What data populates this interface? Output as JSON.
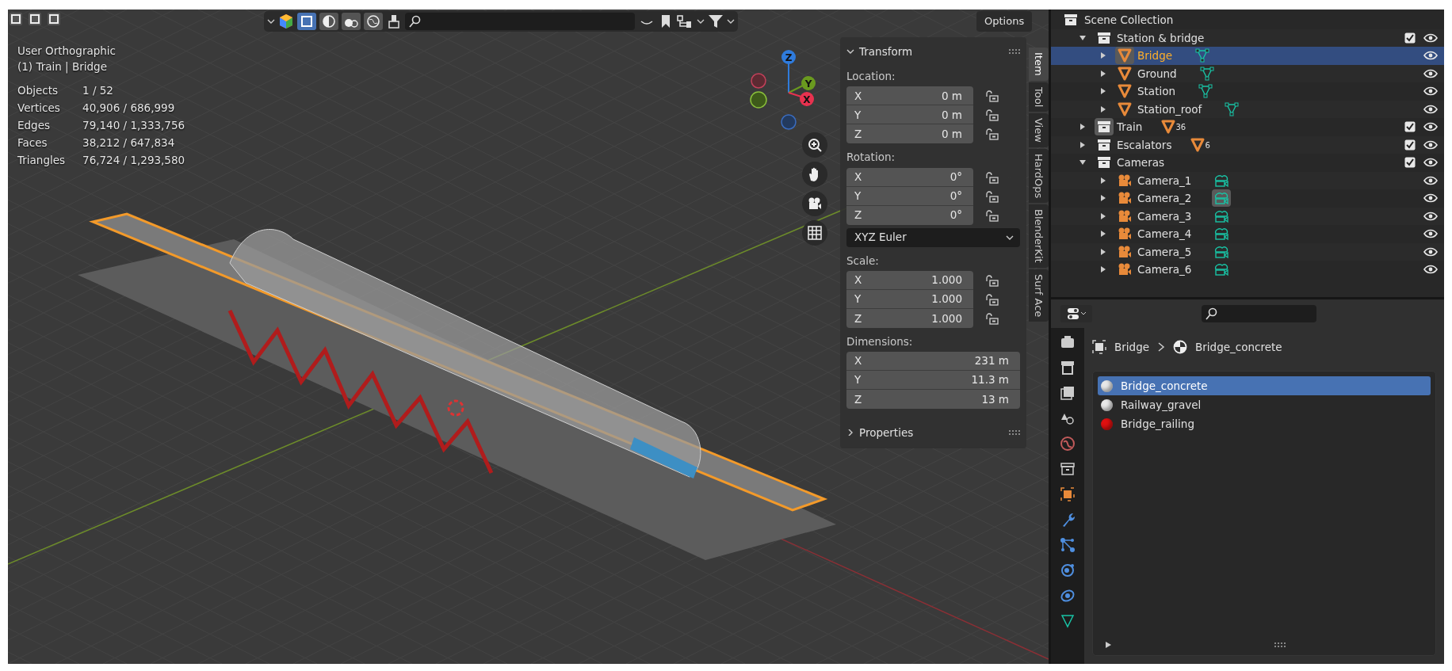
{
  "viewport": {
    "shading_modes": [
      {
        "selected": true
      },
      {
        "selected": false
      },
      {
        "selected": false
      },
      {
        "selected": false
      }
    ],
    "options_button": "Options",
    "view_name": "User Orthographic",
    "context": "(1) Train | Bridge",
    "stats": [
      {
        "label": "Objects",
        "value": "1 / 52"
      },
      {
        "label": "Vertices",
        "value": "40,906 / 686,999"
      },
      {
        "label": "Edges",
        "value": "79,140 / 1,333,756"
      },
      {
        "label": "Faces",
        "value": "38,212 / 647,834"
      },
      {
        "label": "Triangles",
        "value": "76,724 / 1,293,580"
      }
    ],
    "gizmo_axes": [
      {
        "label": "Z"
      },
      {
        "label": "Y"
      },
      {
        "label": "X"
      }
    ]
  },
  "sidebar": {
    "tabs": [
      {
        "label": "Item",
        "selected": true
      },
      {
        "label": "Tool",
        "selected": false
      },
      {
        "label": "View",
        "selected": false
      },
      {
        "label": "HardOps",
        "selected": false
      },
      {
        "label": "BlenderKit",
        "selected": false
      },
      {
        "label": "Surf Ace",
        "selected": false
      }
    ],
    "transform": {
      "title": "Transform",
      "expanded": true,
      "groups": [
        {
          "label": "Location:",
          "lockable": true,
          "fields": [
            {
              "axis": "X",
              "value": "0 m"
            },
            {
              "axis": "Y",
              "value": "0 m"
            },
            {
              "axis": "Z",
              "value": "0 m"
            }
          ]
        },
        {
          "label": "Rotation:",
          "lockable": true,
          "fields": [
            {
              "axis": "X",
              "value": "0°"
            },
            {
              "axis": "Y",
              "value": "0°"
            },
            {
              "axis": "Z",
              "value": "0°"
            }
          ],
          "mode": "XYZ Euler"
        },
        {
          "label": "Scale:",
          "lockable": true,
          "fields": [
            {
              "axis": "X",
              "value": "1.000"
            },
            {
              "axis": "Y",
              "value": "1.000"
            },
            {
              "axis": "Z",
              "value": "1.000"
            }
          ]
        },
        {
          "label": "Dimensions:",
          "lockable": false,
          "fields": [
            {
              "axis": "X",
              "value": "231 m"
            },
            {
              "axis": "Y",
              "value": "11.3 m"
            },
            {
              "axis": "Z",
              "value": "13 m"
            }
          ]
        }
      ]
    },
    "properties_panel": {
      "title": "Properties",
      "expanded": false
    }
  },
  "outliner": {
    "root": "Scene Collection",
    "items": [
      {
        "kind": "collection",
        "label": "Station & bridge",
        "expanded": true,
        "checked": true,
        "active": false,
        "selected": false,
        "children": [
          {
            "kind": "mesh",
            "label": "Bridge",
            "expanded": false,
            "active": true,
            "selected": true,
            "active_data": false
          },
          {
            "kind": "mesh",
            "label": "Ground",
            "expanded": false,
            "active": false,
            "selected": false,
            "active_data": false
          },
          {
            "kind": "mesh",
            "label": "Station",
            "expanded": false,
            "active": false,
            "selected": false,
            "active_data": false
          },
          {
            "kind": "mesh",
            "label": "Station_roof",
            "expanded": false,
            "active": false,
            "selected": false,
            "active_data": false
          }
        ]
      },
      {
        "kind": "collection",
        "label": "Train",
        "expanded": false,
        "checked": true,
        "active": true,
        "selected": false,
        "count": "36"
      },
      {
        "kind": "collection",
        "label": "Escalators",
        "expanded": false,
        "checked": true,
        "active": false,
        "selected": false,
        "count": "6"
      },
      {
        "kind": "collection",
        "label": "Cameras",
        "expanded": true,
        "checked": true,
        "active": false,
        "selected": false,
        "children": [
          {
            "kind": "camera",
            "label": "Camera_1",
            "expanded": false,
            "active": false,
            "selected": false,
            "active_data": false
          },
          {
            "kind": "camera",
            "label": "Camera_2",
            "expanded": false,
            "active": false,
            "selected": false,
            "active_data": true
          },
          {
            "kind": "camera",
            "label": "Camera_3",
            "expanded": false,
            "active": false,
            "selected": false,
            "active_data": false
          },
          {
            "kind": "camera",
            "label": "Camera_4",
            "expanded": false,
            "active": false,
            "selected": false,
            "active_data": false
          },
          {
            "kind": "camera",
            "label": "Camera_5",
            "expanded": false,
            "active": false,
            "selected": false,
            "active_data": false
          },
          {
            "kind": "camera",
            "label": "Camera_6",
            "expanded": false,
            "active": false,
            "selected": false,
            "active_data": false
          }
        ]
      }
    ]
  },
  "properties": {
    "breadcrumb": [
      "Bridge",
      "Bridge_concrete"
    ],
    "material_slots": [
      {
        "name": "Bridge_concrete",
        "color": "#e8e8e8",
        "selected": true
      },
      {
        "name": "Railway_gravel",
        "color": "#e8e8e8",
        "selected": false
      },
      {
        "name": "Bridge_railing",
        "color": "#e01010",
        "selected": false
      }
    ]
  }
}
